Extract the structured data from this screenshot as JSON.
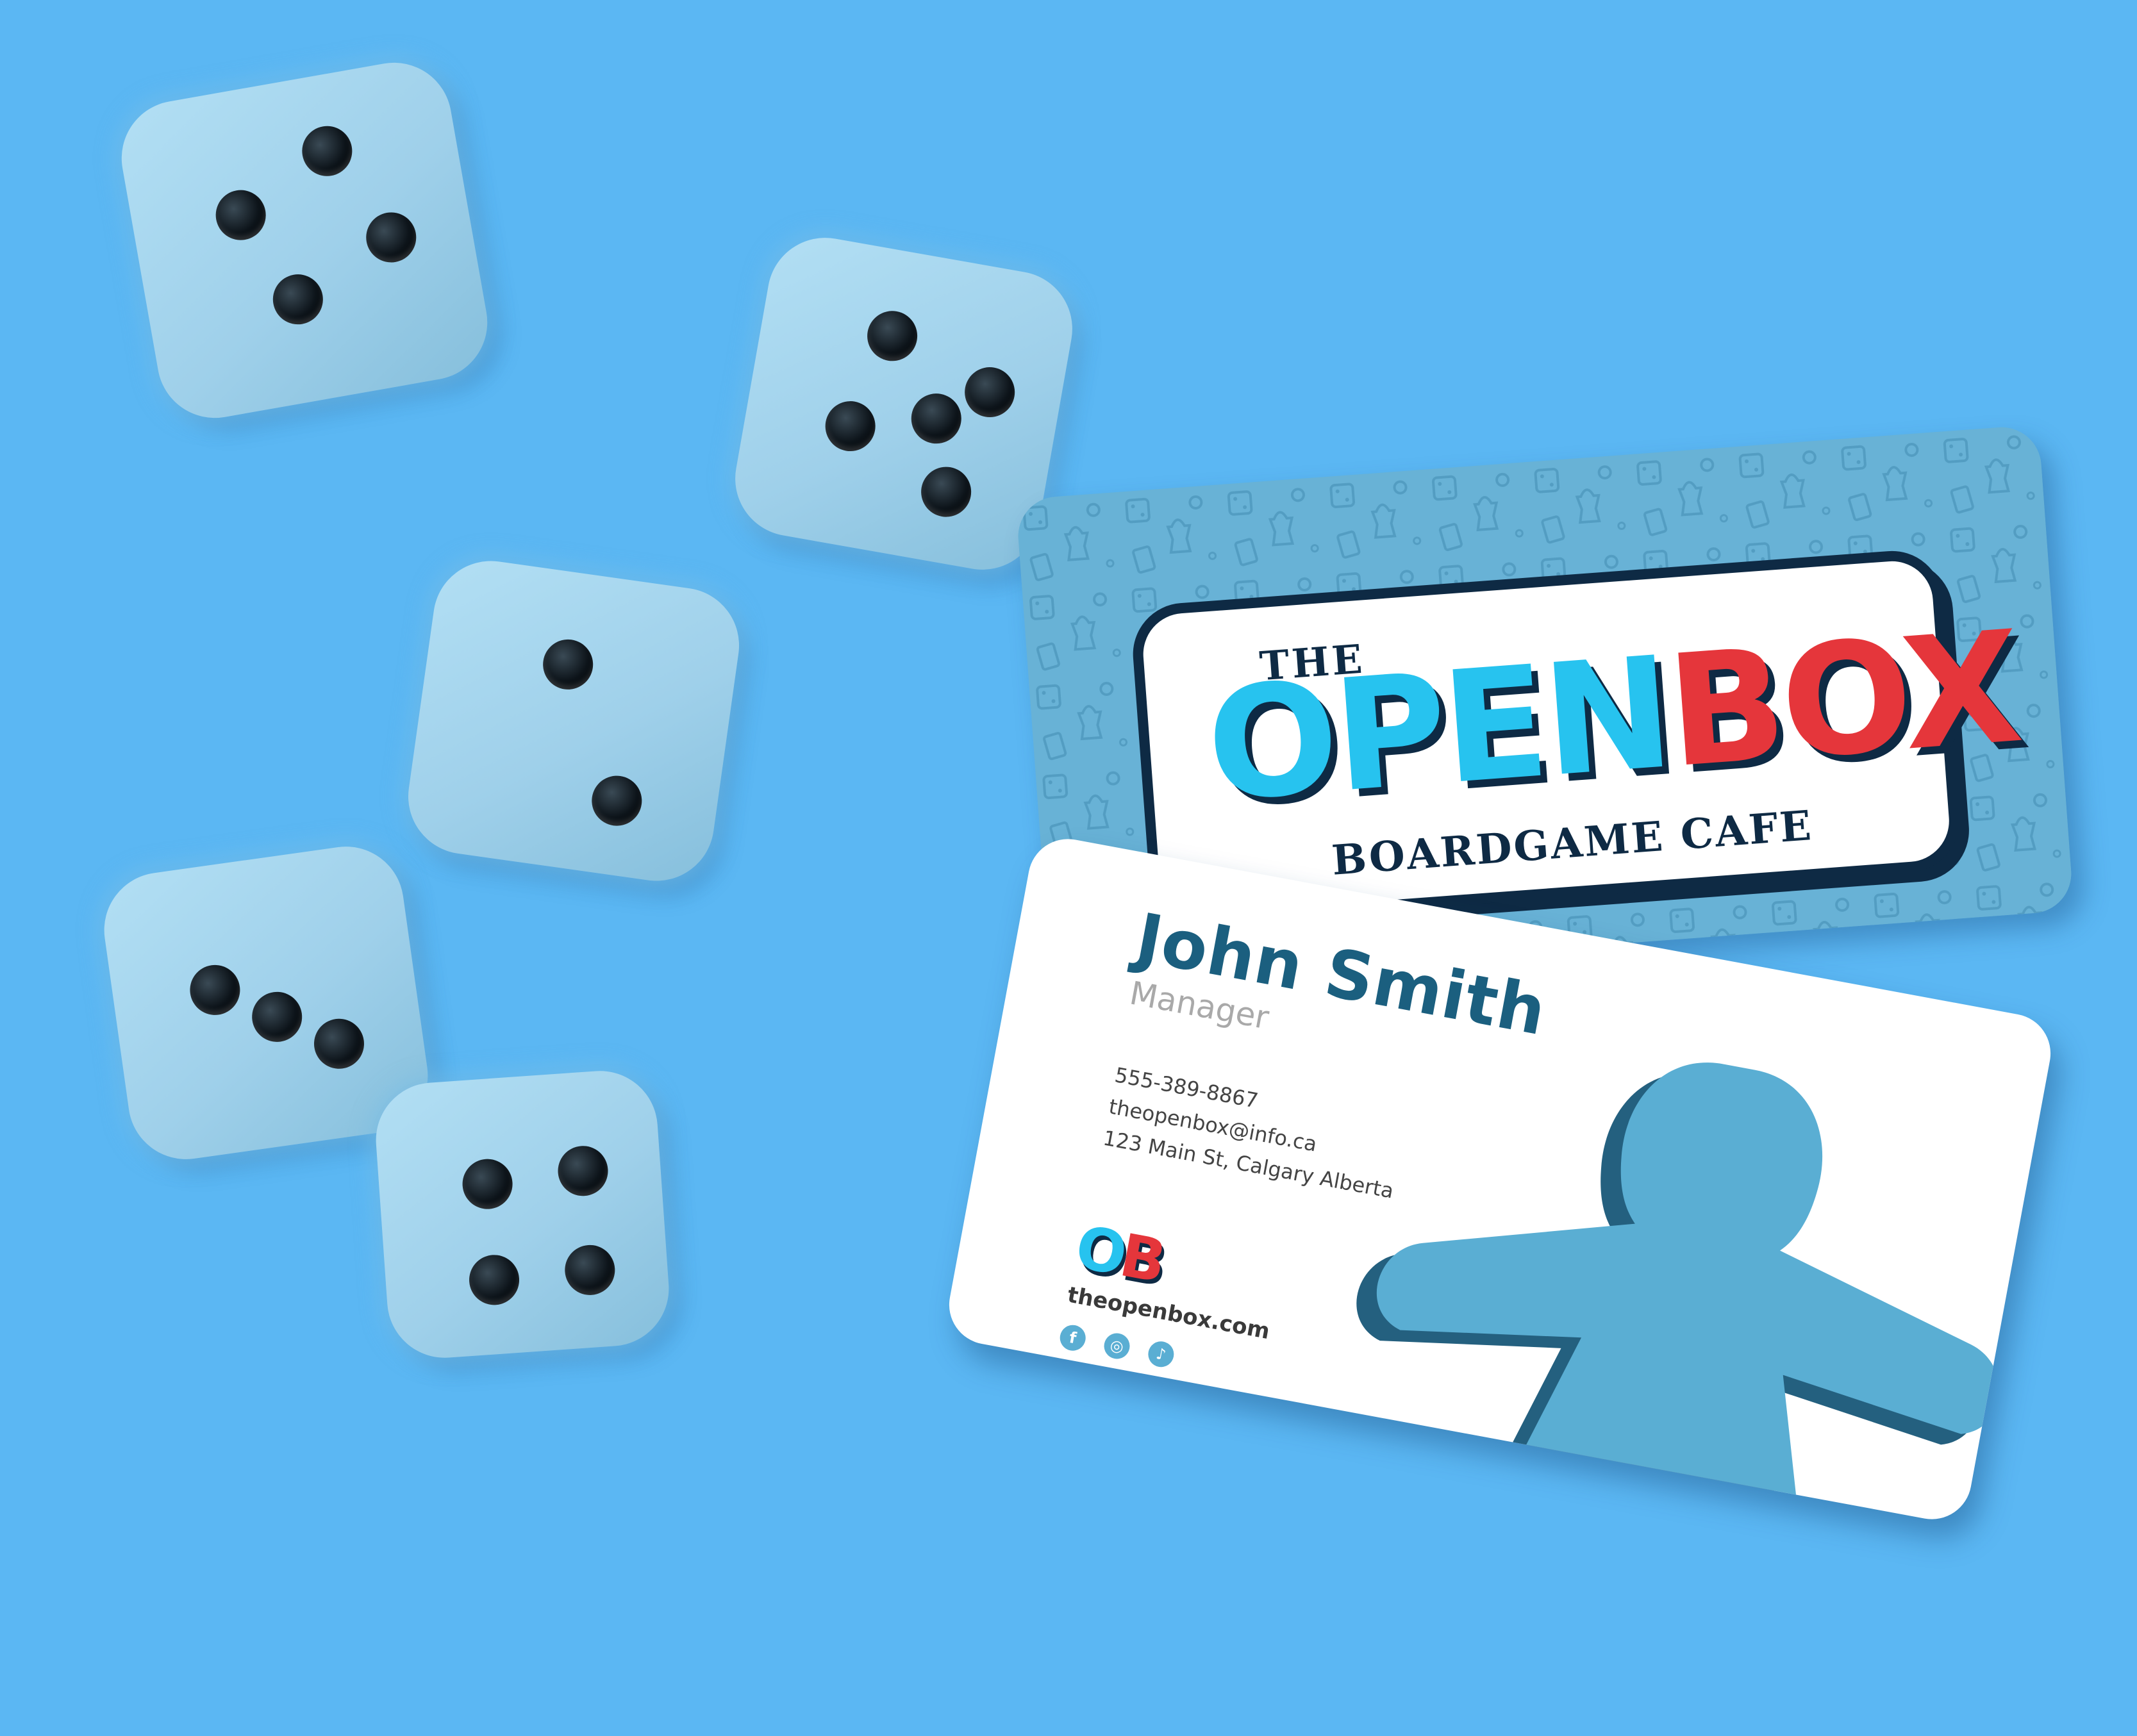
{
  "background_color": "#5bb7f3",
  "dice": [
    {
      "name": "die-four-top-left",
      "pips": 4
    },
    {
      "name": "die-five-top-center",
      "pips": 5
    },
    {
      "name": "die-two-middle",
      "pips": 2
    },
    {
      "name": "die-three-left",
      "pips": 3
    },
    {
      "name": "die-four-bottom",
      "pips": 4
    }
  ],
  "card_back": {
    "pattern": "boardgame-doodle-pattern",
    "logo": {
      "the": "THE",
      "open": "OPEN",
      "box": "BOX",
      "tagline": "BOARDGAME CAFE"
    },
    "colors": {
      "card": "#68b2d6",
      "open": "#27c3ef",
      "box": "#e5363b",
      "outline": "#0e2a44"
    }
  },
  "card_front": {
    "name": "John Smith",
    "role": "Manager",
    "phone": "555-389-8867",
    "email": "theopenbox@info.ca",
    "address": "123 Main St, Calgary Alberta",
    "logo_initials": {
      "o": "O",
      "b": "B"
    },
    "website": "theopenbox.com",
    "social_icons": [
      "facebook-icon",
      "instagram-icon",
      "tiktok-icon"
    ],
    "social_glyphs": {
      "facebook": "f",
      "instagram": "◎",
      "tiktok": "♪"
    },
    "illustration": "meeple-figure",
    "colors": {
      "name": "#1b5f7f",
      "meeple": "#5aaed3",
      "meeple_shadow": "#24607f"
    }
  }
}
